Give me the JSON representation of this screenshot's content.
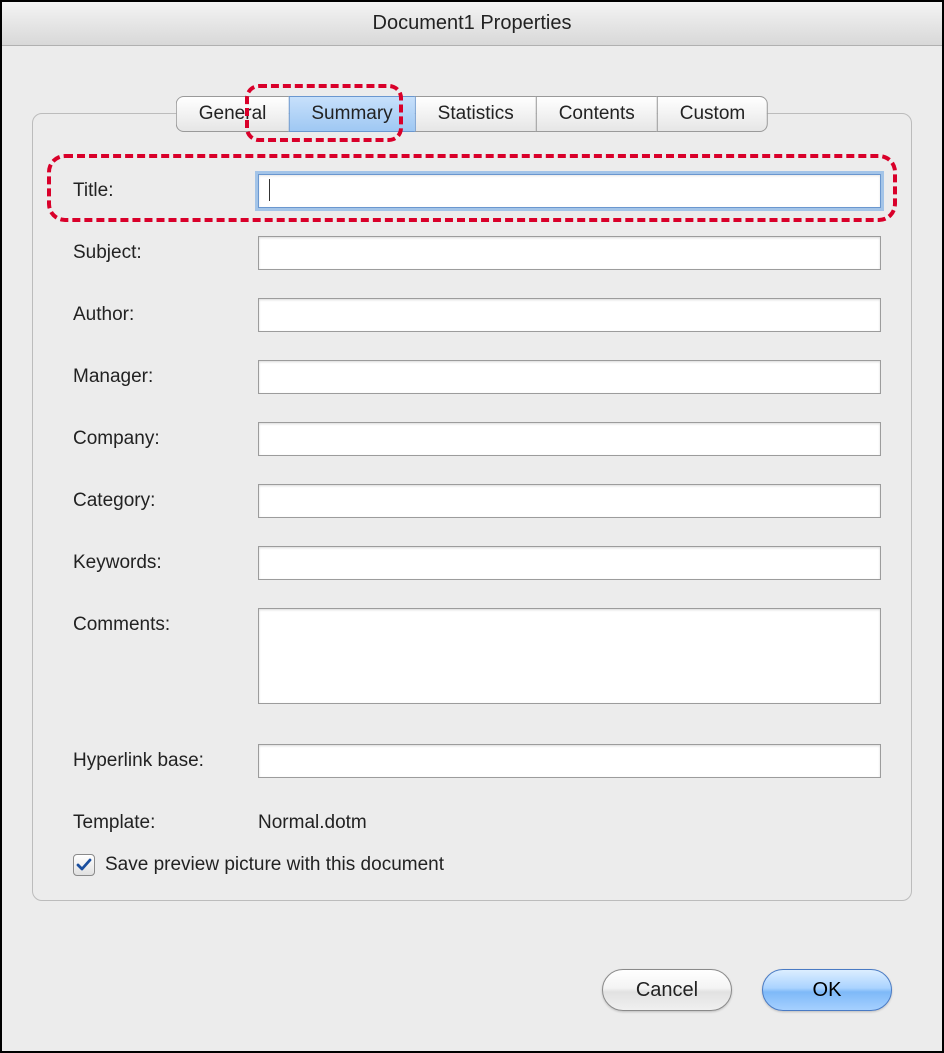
{
  "window": {
    "title": "Document1 Properties"
  },
  "tabs": [
    {
      "label": "General",
      "active": false
    },
    {
      "label": "Summary",
      "active": true
    },
    {
      "label": "Statistics",
      "active": false
    },
    {
      "label": "Contents",
      "active": false
    },
    {
      "label": "Custom",
      "active": false
    }
  ],
  "form": {
    "title": {
      "label": "Title:",
      "value": ""
    },
    "subject": {
      "label": "Subject:",
      "value": ""
    },
    "author": {
      "label": "Author:",
      "value": ""
    },
    "manager": {
      "label": "Manager:",
      "value": ""
    },
    "company": {
      "label": "Company:",
      "value": ""
    },
    "category": {
      "label": "Category:",
      "value": ""
    },
    "keywords": {
      "label": "Keywords:",
      "value": ""
    },
    "comments": {
      "label": "Comments:",
      "value": ""
    },
    "hyperlink_base": {
      "label": "Hyperlink base:",
      "value": ""
    },
    "template": {
      "label": "Template:",
      "value": "Normal.dotm"
    },
    "save_preview": {
      "label": "Save preview picture with this document",
      "checked": true
    }
  },
  "buttons": {
    "cancel": "Cancel",
    "ok": "OK"
  },
  "annotations": {
    "highlight_tab": "Summary",
    "highlight_row": "title"
  }
}
